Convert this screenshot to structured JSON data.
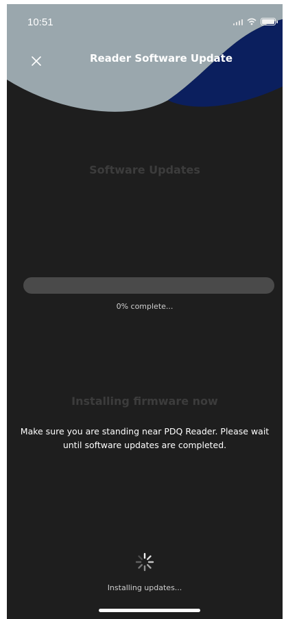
{
  "status_bar": {
    "time": "10:51"
  },
  "header": {
    "title": "Reader Software Update",
    "close_icon": "close-icon",
    "colors": {
      "wave_gray": "#9aa7ad",
      "wave_blue": "#0b1f5e"
    }
  },
  "software_updates": {
    "title": "Software Updates",
    "progress_value": 0,
    "progress_text": "0% complete..."
  },
  "install": {
    "title": "Installing firmware now",
    "message": "Make sure you are standing near PDQ Reader. Please wait until software updates are completed."
  },
  "footer": {
    "spinner_icon": "spinner-icon",
    "status": "Installing updates..."
  },
  "colors": {
    "background": "#1e1e1e",
    "muted_text": "#3c3c3c",
    "progress_track": "#4a4a4a"
  }
}
